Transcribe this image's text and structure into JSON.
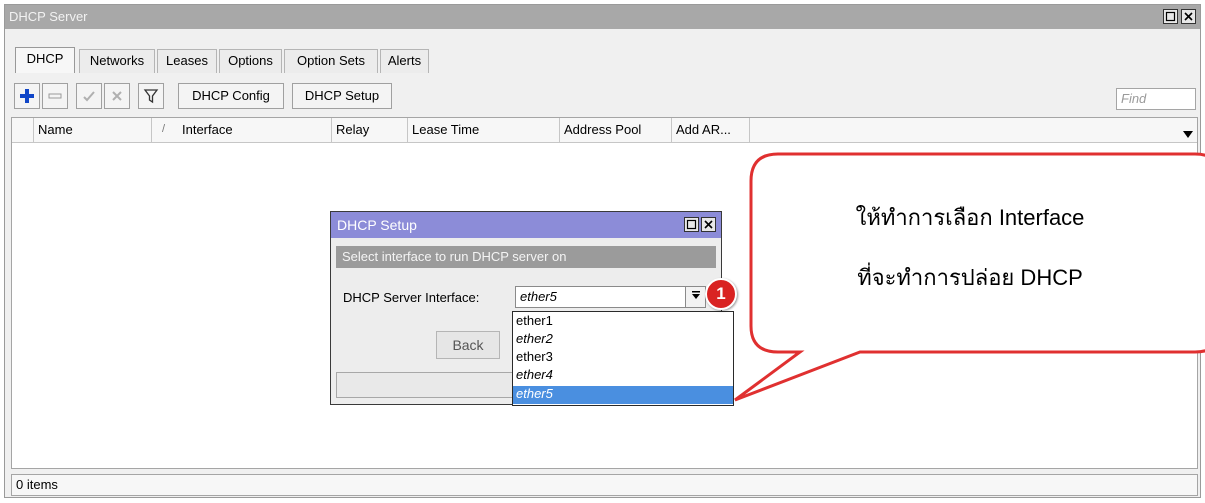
{
  "window": {
    "title": "DHCP Server"
  },
  "tabs": [
    {
      "label": "DHCP",
      "active": true
    },
    {
      "label": "Networks",
      "active": false
    },
    {
      "label": "Leases",
      "active": false
    },
    {
      "label": "Options",
      "active": false
    },
    {
      "label": "Option Sets",
      "active": false
    },
    {
      "label": "Alerts",
      "active": false
    }
  ],
  "toolbar": {
    "icons": [
      "add-icon",
      "remove-icon",
      "enable-icon",
      "disable-icon",
      "filter-icon"
    ],
    "dhcp_config": "DHCP Config",
    "dhcp_setup": "DHCP Setup",
    "find_placeholder": "Find"
  },
  "table": {
    "columns": [
      "Name",
      "/",
      "Interface",
      "Relay",
      "Lease Time",
      "Address Pool",
      "Add AR..."
    ],
    "rows": []
  },
  "status": {
    "count": "0 items"
  },
  "dialog": {
    "title": "DHCP Setup",
    "subheader": "Select interface to run DHCP server on",
    "label": "DHCP Server Interface:",
    "value": "ether5",
    "back": "Back",
    "options": [
      {
        "label": "ether1",
        "italic": false,
        "selected": false
      },
      {
        "label": "ether2",
        "italic": true,
        "selected": false
      },
      {
        "label": "ether3",
        "italic": false,
        "selected": false
      },
      {
        "label": "ether4",
        "italic": true,
        "selected": false
      },
      {
        "label": "ether5",
        "italic": true,
        "selected": true
      }
    ]
  },
  "annotation": {
    "number": "1",
    "line1": "ให้ทำการเลือก Interface",
    "line2": "ที่จะทำการปล่อย DHCP",
    "callout_color": "#e03030",
    "badge_color": "#d92322"
  },
  "colors": {
    "titlebar": "#a8a8a8",
    "dialog_titlebar": "#8c8cd8",
    "selection": "#4a8fe0"
  }
}
